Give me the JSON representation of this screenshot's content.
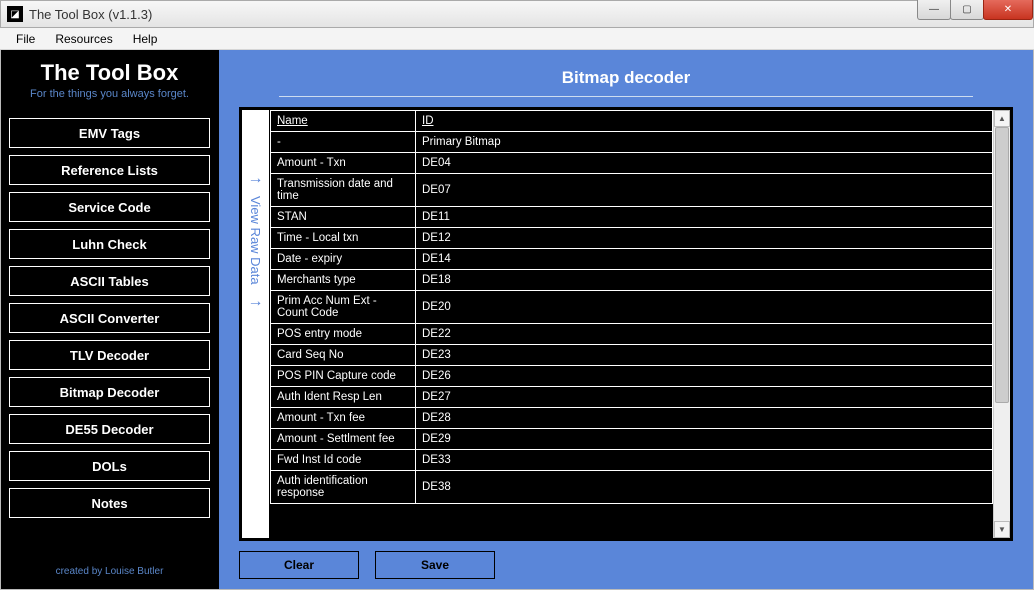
{
  "window": {
    "title": "The Tool Box (v1.1.3)"
  },
  "menu": {
    "file": "File",
    "resources": "Resources",
    "help": "Help"
  },
  "sidebar": {
    "title": "The Tool Box",
    "tagline": "For the things you always forget.",
    "items": [
      "EMV Tags",
      "Reference Lists",
      "Service Code",
      "Luhn Check",
      "ASCII Tables",
      "ASCII Converter",
      "TLV Decoder",
      "Bitmap Decoder",
      "DE55 Decoder",
      "DOLs",
      "Notes"
    ],
    "credit": "created by Louise Butler"
  },
  "main": {
    "title": "Bitmap decoder",
    "collapsed_label": "View Raw Data",
    "columns": {
      "name": "Name",
      "id": "ID"
    },
    "rows": [
      {
        "name": "-",
        "id": "Primary Bitmap"
      },
      {
        "name": "Amount - Txn",
        "id": "DE04"
      },
      {
        "name": "Transmission date and time",
        "id": "DE07"
      },
      {
        "name": "STAN",
        "id": "DE11"
      },
      {
        "name": "Time - Local txn",
        "id": "DE12"
      },
      {
        "name": "Date - expiry",
        "id": "DE14"
      },
      {
        "name": "Merchants type",
        "id": "DE18"
      },
      {
        "name": "Prim Acc Num Ext - Count Code",
        "id": "DE20"
      },
      {
        "name": "POS entry mode",
        "id": "DE22"
      },
      {
        "name": "Card Seq No",
        "id": "DE23"
      },
      {
        "name": "POS PIN Capture code",
        "id": "DE26"
      },
      {
        "name": "Auth Ident Resp Len",
        "id": "DE27"
      },
      {
        "name": "Amount - Txn fee",
        "id": "DE28"
      },
      {
        "name": "Amount - Settlment fee",
        "id": "DE29"
      },
      {
        "name": "Fwd Inst Id code",
        "id": "DE33"
      },
      {
        "name": "Auth identification response",
        "id": "DE38"
      }
    ],
    "buttons": {
      "clear": "Clear",
      "save": "Save"
    }
  }
}
